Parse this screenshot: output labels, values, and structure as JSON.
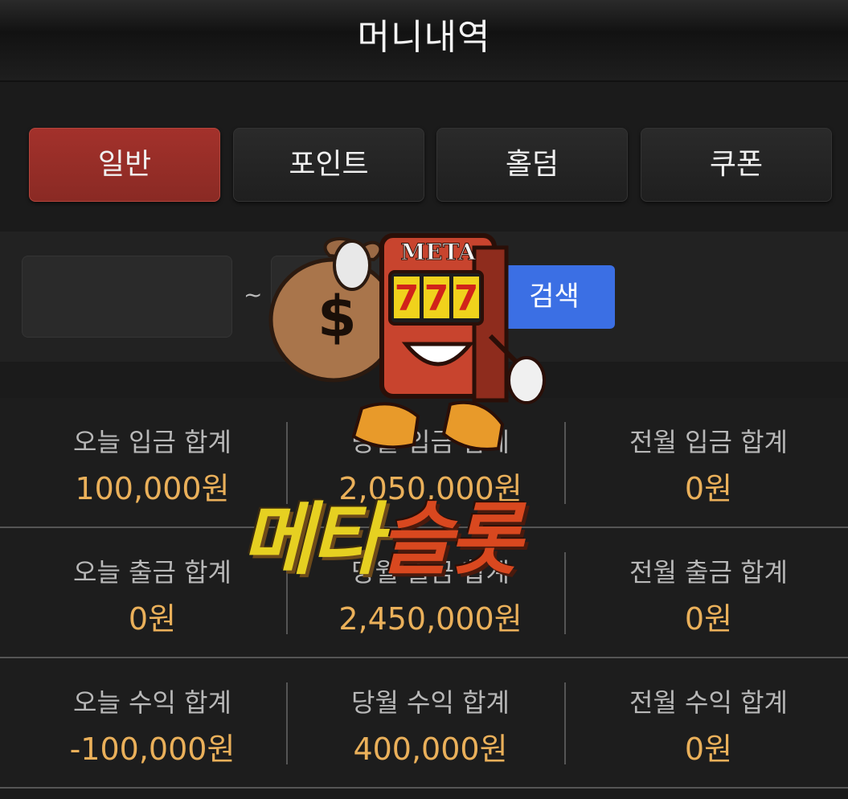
{
  "header": {
    "title": "머니내역"
  },
  "tabs": [
    {
      "label": "일반",
      "active": true
    },
    {
      "label": "포인트",
      "active": false
    },
    {
      "label": "홀덤",
      "active": false
    },
    {
      "label": "쿠폰",
      "active": false
    }
  ],
  "search": {
    "start_date": "",
    "end_date": "",
    "separator": "~",
    "button_label": "검색"
  },
  "stats": {
    "rows": [
      [
        {
          "label": "오늘 입금 합계",
          "value": "100,000원"
        },
        {
          "label": "당월 입금 합계",
          "value": "2,050,000원"
        },
        {
          "label": "전월 입금 합계",
          "value": "0원"
        }
      ],
      [
        {
          "label": "오늘 출금 합계",
          "value": "0원"
        },
        {
          "label": "당월 출금 합계",
          "value": "2,450,000원"
        },
        {
          "label": "전월 출금 합계",
          "value": "0원"
        }
      ],
      [
        {
          "label": "오늘 수익 합계",
          "value": "-100,000원"
        },
        {
          "label": "당월 수익 합계",
          "value": "400,000원"
        },
        {
          "label": "전월 수익 합계",
          "value": "0원"
        }
      ]
    ]
  },
  "watermark": {
    "sign_text": "META",
    "reels": [
      "7",
      "7",
      "7"
    ],
    "bag_symbol": "$",
    "brand_part1": "메타",
    "brand_part2": "슬롯"
  },
  "colors": {
    "active_tab": "#9a2f29",
    "search_button": "#3b6fe4",
    "stat_value": "#eab05a",
    "background": "#1b1b1b"
  }
}
